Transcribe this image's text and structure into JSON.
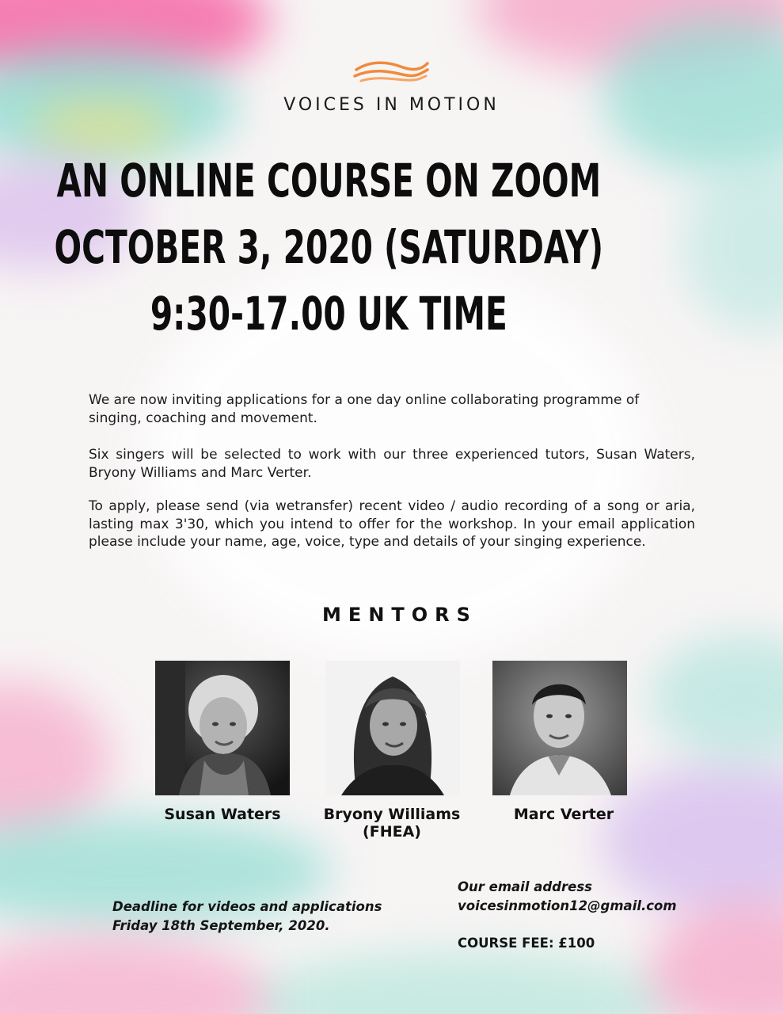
{
  "brand": "VOICES IN MOTION",
  "headline": {
    "line1": "AN ONLINE COURSE ON ZOOM",
    "line2": "OCTOBER 3, 2020 (SATURDAY)",
    "line3": "9:30-17.00 UK TIME"
  },
  "paragraphs": [
    "We are now inviting applications for a one day online collaborating programme of singing, coaching and movement.",
    "Six singers will be selected to work with our three experienced tutors, Susan Waters, Bryony Williams and Marc Verter.",
    "To apply, please send (via wetransfer) recent video / audio recording of a song or aria, lasting max 3'30, which you intend to offer for the workshop. In your email application please include your name, age, voice, type and details of your singing experience."
  ],
  "mentors_title": "MENTORS",
  "mentors": [
    {
      "name": "Susan Waters"
    },
    {
      "name": "Bryony Williams",
      "name2": "(FHEA)"
    },
    {
      "name": "Marc Verter"
    }
  ],
  "deadline": {
    "line1": "Deadline for videos and applications",
    "line2": "Friday 18th September, 2020."
  },
  "email": {
    "label": "Our email address",
    "address": "voicesinmotion12@gmail.com"
  },
  "fee": "COURSE FEE: £100",
  "colors": {
    "logo_orange": "#f08a3c",
    "pink": "#f46aa6",
    "teal": "#7fd6cf"
  }
}
